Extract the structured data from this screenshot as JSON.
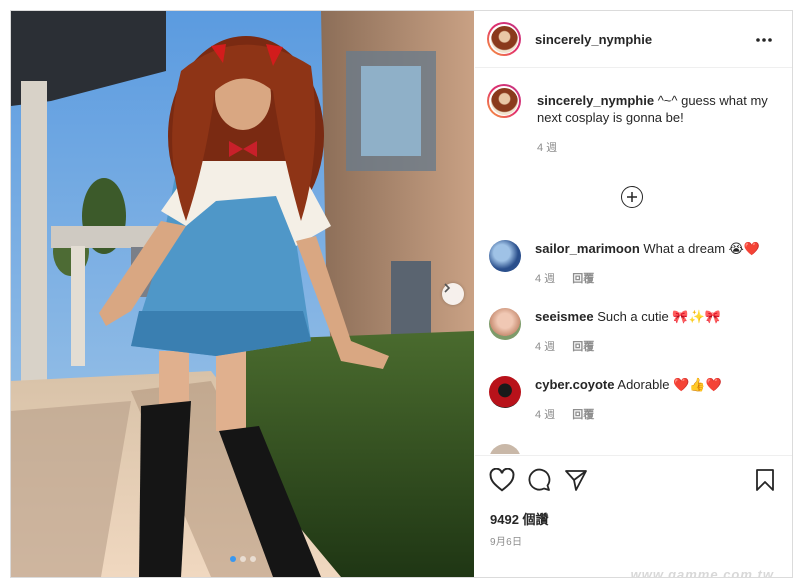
{
  "post": {
    "author": "sincerely_nymphie",
    "caption_user": "sincerely_nymphie",
    "caption_text": "^~^ guess what my next cosplay is gonna be!",
    "caption_time": "4 週",
    "likes": "9492 個讚",
    "date": "9月6日",
    "watermark": "www.gamme.com.tw",
    "carousel_index": 1,
    "carousel_total": 3
  },
  "comments": [
    {
      "user": "sailor_marimoon",
      "text": "What a dream",
      "emoji": "😭❤️",
      "time": "4 週",
      "reply": "回覆",
      "avatar_color": "#2a4f8c"
    },
    {
      "user": "seeismee",
      "text": "Such a cutie",
      "emoji": "🎀✨🎀",
      "time": "4 週",
      "reply": "回覆",
      "avatar_color": "#c98f74"
    },
    {
      "user": "cyber.coyote",
      "text": "Adorable",
      "emoji": "❤️👍❤️",
      "time": "4 週",
      "reply": "回覆",
      "avatar_color": "#b8121a"
    }
  ],
  "icons": {
    "more": "more-options-icon",
    "like": "heart-icon",
    "comment": "comment-icon",
    "share": "share-icon",
    "save": "bookmark-icon",
    "load_more": "plus-circle-icon",
    "next": "chevron-right-icon"
  },
  "colors": {
    "accent": "#3897f0",
    "text": "#262626",
    "muted": "#8e8e8e",
    "border": "#dbdbdb"
  }
}
